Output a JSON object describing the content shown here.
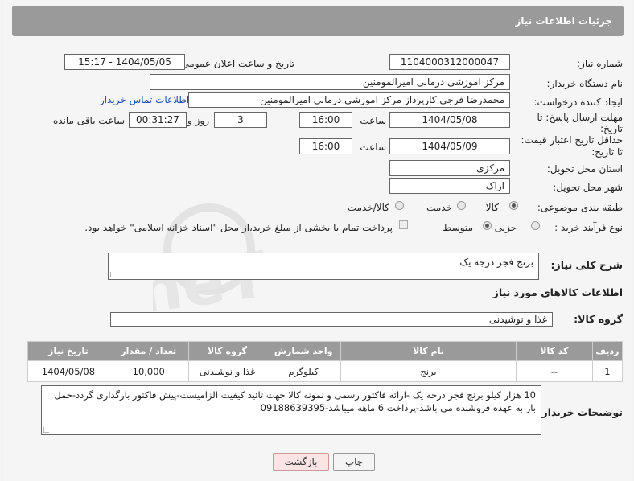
{
  "header": {
    "title": "جزئیات اطلاعات نیاز"
  },
  "fields": {
    "need_number_label": "شماره نیاز:",
    "need_number": "1104000312000047",
    "announce_label": "تاریخ و ساعت اعلان عمومی:",
    "announce_value": "1404/05/05 - 15:17",
    "buyer_org_label": "نام دستگاه خریدار:",
    "buyer_org": "مرکز اموزشی درمانی امیرالمومنین",
    "requester_label": "ایجاد کننده درخواست:",
    "requester": "محمدرضا فرجی کارپرداز مرکز اموزشی درمانی امیرالمومنین",
    "contact_link": "اطلاعات تماس خریدار",
    "deadline_label_1": "مهلت ارسال پاسخ: تا",
    "deadline_label_2": "تاریخ:",
    "deadline_date": "1404/05/08",
    "time_label": "ساعت",
    "deadline_time": "16:00",
    "days_value": "3",
    "days_label": "روز و",
    "remaining_time": "00:31:27",
    "remaining_label": "ساعت باقی مانده",
    "price_valid_label_1": "حداقل تاریخ اعتبار قیمت:",
    "price_valid_label_2": "تا تاریخ:",
    "price_valid_date": "1404/05/09",
    "price_valid_time": "16:00",
    "province_label": "استان محل تحویل:",
    "province": "مرکزی",
    "city_label": "شهر محل تحویل:",
    "city": "اراک",
    "category_label": "طبقه بندی موضوعی:",
    "category_options": [
      "کالا",
      "خدمت",
      "کالا/خدمت"
    ],
    "category_selected": "کالا",
    "process_label": "نوع فرآیند خرید :",
    "process_options": [
      "جزیی",
      "متوسط"
    ],
    "process_selected": "متوسط",
    "payment_note": "پرداخت تمام یا بخشی از مبلغ خرید،از محل \"اسناد خزانه اسلامی\" خواهد بود."
  },
  "summary": {
    "label": "شرح کلی نیاز:",
    "value": "برنج فجر درجه یک"
  },
  "goods_section": {
    "title": "اطلاعات کالاهای مورد نیاز",
    "group_label": "گروه کالا:",
    "group_value": "غذا و نوشیدنی"
  },
  "table": {
    "headers": [
      "ردیف",
      "کد کالا",
      "نام کالا",
      "واحد شمارش",
      "گروه کالا",
      "تعداد / مقدار",
      "تاریخ نیاز"
    ],
    "rows": [
      [
        "1",
        "--",
        "برنج",
        "کیلوگرم",
        "غذا و نوشیدنی",
        "10,000",
        "1404/05/08"
      ]
    ]
  },
  "buyer_notes": {
    "label": "توضیحات خریدار:",
    "line1": "10 هزار کیلو برنج فجر درجه یک -ارائه فاکتور رسمی و نمونه کالا جهت تائید کیفیت الزامیست-پیش فاکتور بارگذاری گردد-حمل",
    "line2": "بار به عهده فروشنده می باشد-پرداخت 6 ماهه میباشد-09188639395"
  },
  "buttons": {
    "print": "چاپ",
    "back": "بازگشت"
  },
  "colors": {
    "header_bg": "#9a9a9a",
    "link": "#1a4db3",
    "back_btn_bg": "#fbe4e4"
  }
}
